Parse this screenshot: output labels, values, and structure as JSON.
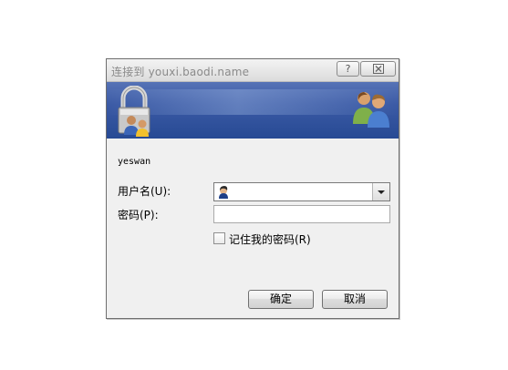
{
  "dialog": {
    "title": "连接到 youxi.baodi.name",
    "help_glyph": "?",
    "close_glyph": "☒"
  },
  "form": {
    "username_display": "yeswan",
    "username_label": "用户名(U):",
    "password_label": "密码(P):",
    "username_value": "",
    "password_value": "",
    "remember_label": "记住我的密码(R)",
    "remember_checked": false
  },
  "buttons": {
    "ok_label": "确定",
    "cancel_label": "取消"
  },
  "icons": {
    "banner_left": "lock-users-icon",
    "banner_right": "users-icon",
    "combo_avatar": "user-avatar-icon",
    "dropdown": "chevron-down-icon"
  },
  "colors": {
    "banner_top": "#5673b6",
    "banner_bottom": "#274a94",
    "dialog_bg": "#f0f0f0",
    "title_text": "#8a8a8a"
  }
}
